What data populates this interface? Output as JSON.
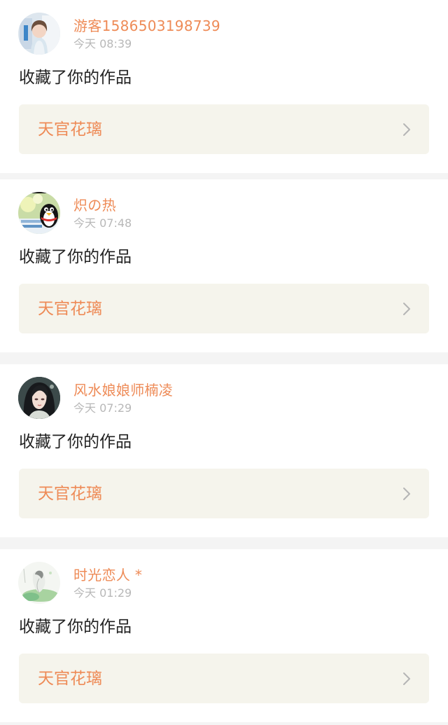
{
  "notifications": [
    {
      "username": "游客1586503198739",
      "time": "今天 08:39",
      "action": "收藏了你的作品",
      "work_title": "天官花璃",
      "avatar_icon": "avatar-girl-photo-icon"
    },
    {
      "username": "炽の热",
      "time": "今天 07:48",
      "action": "收藏了你的作品",
      "work_title": "天官花璃",
      "avatar_icon": "avatar-qq-penguin-icon"
    },
    {
      "username": "风水娘娘师楠凌",
      "time": "今天 07:29",
      "action": "收藏了你的作品",
      "work_title": "天官花璃",
      "avatar_icon": "avatar-anime-woman-icon"
    },
    {
      "username": "时光恋人 *",
      "time": "今天 01:29",
      "action": "收藏了你的作品",
      "work_title": "天官花璃",
      "avatar_icon": "avatar-ink-painting-icon"
    }
  ],
  "colors": {
    "accent": "#ee8b57",
    "timestamp": "#b8b8b8",
    "text": "#222222",
    "link_background": "#f5f4ec",
    "page_background": "#f4f4f4",
    "card_background": "#ffffff"
  }
}
